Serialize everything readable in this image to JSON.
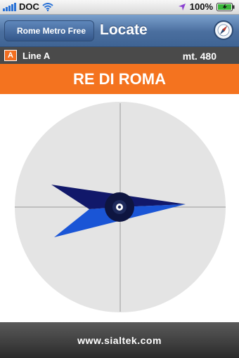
{
  "status_bar": {
    "carrier": "DOC",
    "battery": "100%",
    "icons": [
      "signal-bars-icon",
      "wifi-icon",
      "location-arrow-icon",
      "battery-icon"
    ]
  },
  "nav": {
    "back_label": "Rome Metro Free",
    "title": "Locate",
    "compass_icon": "compass-icon"
  },
  "line": {
    "badge": "A",
    "name": "Line A",
    "distance": "mt. 480"
  },
  "station": {
    "name": "RE DI ROMA"
  },
  "compass": {
    "dial_icon": "compass-dial",
    "needle_icon": "direction-needle-icon"
  },
  "footer": {
    "url": "www.sialtek.com"
  },
  "colors": {
    "accent_orange": "#f4731f",
    "nav_blue": "#4a6e9e",
    "needle_dark": "#11186a",
    "needle_light": "#1a55d6",
    "dial_gray": "#e4e4e4"
  }
}
